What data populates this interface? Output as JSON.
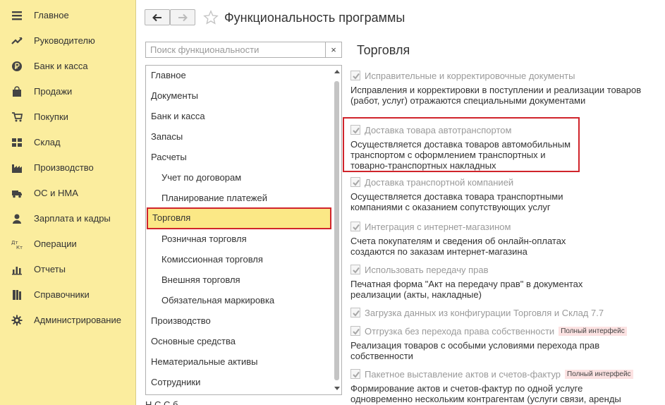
{
  "header": {
    "title": "Функциональность программы"
  },
  "sidebar": {
    "items": [
      {
        "label": "Главное",
        "icon": "menu-icon"
      },
      {
        "label": "Руководителю",
        "icon": "trend-icon"
      },
      {
        "label": "Банк и касса",
        "icon": "ruble-icon"
      },
      {
        "label": "Продажи",
        "icon": "shopping-bag-icon"
      },
      {
        "label": "Покупки",
        "icon": "cart-icon"
      },
      {
        "label": "Склад",
        "icon": "warehouse-icon"
      },
      {
        "label": "Производство",
        "icon": "factory-icon"
      },
      {
        "label": "ОС и НМА",
        "icon": "truck-icon"
      },
      {
        "label": "Зарплата и кадры",
        "icon": "person-icon"
      },
      {
        "label": "Операции",
        "icon": "dt-kt-icon"
      },
      {
        "label": "Отчеты",
        "icon": "bar-chart-icon"
      },
      {
        "label": "Справочники",
        "icon": "books-icon"
      },
      {
        "label": "Администрирование",
        "icon": "gear-icon"
      }
    ]
  },
  "search": {
    "placeholder": "Поиск функциональности",
    "clear": "×"
  },
  "tree": {
    "items": [
      {
        "label": "Главное",
        "level": 0
      },
      {
        "label": "Документы",
        "level": 0
      },
      {
        "label": "Банк и касса",
        "level": 0
      },
      {
        "label": "Запасы",
        "level": 0
      },
      {
        "label": "Расчеты",
        "level": 0
      },
      {
        "label": "Учет по договорам",
        "level": 1
      },
      {
        "label": "Планирование платежей",
        "level": 1
      },
      {
        "label": "Торговля",
        "level": 0,
        "selected": true
      },
      {
        "label": "Розничная торговля",
        "level": 1
      },
      {
        "label": "Комиссионная торговля",
        "level": 1
      },
      {
        "label": "Внешняя торговля",
        "level": 1
      },
      {
        "label": "Обязательная маркировка",
        "level": 1
      },
      {
        "label": "Производство",
        "level": 0
      },
      {
        "label": "Основные средства",
        "level": 0
      },
      {
        "label": "Нематериальные активы",
        "level": 0
      },
      {
        "label": "Сотрудники",
        "level": 0
      }
    ],
    "bottom_text": "Н                                     С  С  б"
  },
  "section": {
    "title": "Торговля",
    "options": [
      {
        "label": "Исправительные и корректировочные документы",
        "checked": true,
        "desc": "Исправления и корректировки в поступлении и реализации товаров (работ, услуг) отражаются специальными документами"
      },
      {
        "label": "Доставка товара автотранспортом",
        "checked": true,
        "desc": "Осуществляется доставка товаров автомобильным транспортом с оформлением транспортных и товарно-транспортных накладных"
      },
      {
        "label": "Доставка транспортной компанией",
        "checked": true,
        "desc": "Осуществляется доставка товара транспортными компаниями с оказанием сопутствующих услуг"
      },
      {
        "label": "Интеграция с интернет-магазином",
        "checked": true,
        "desc": "Счета покупателям и сведения об онлайн-оплатах создаются по заказам интернет-магазина"
      },
      {
        "label": "Использовать передачу прав",
        "checked": true,
        "desc": "Печатная форма \"Акт на передачу прав\" в документах реализации (акты, накладные)"
      },
      {
        "label": "Загрузка данных из конфигурации Торговля и Склад 7.7",
        "checked": true,
        "desc": ""
      },
      {
        "label": "Отгрузка без перехода права собственности",
        "checked": true,
        "badge": "Полный интерфейс",
        "desc": "Реализация товаров с особыми условиями перехода прав собственности"
      },
      {
        "label": "Пакетное выставление актов и счетов-фактур",
        "checked": true,
        "badge": "Полный интерфейс",
        "desc": "Формирование актов и счетов-фактур по одной услуге одновременно нескольким контрагентам (услуги связи, аренды"
      }
    ]
  },
  "colors": {
    "sidebar_bg": "#fbed9e",
    "selected_bg": "#fbe886",
    "highlight_border": "#d0242b",
    "badge_bg": "#fce2e2"
  }
}
